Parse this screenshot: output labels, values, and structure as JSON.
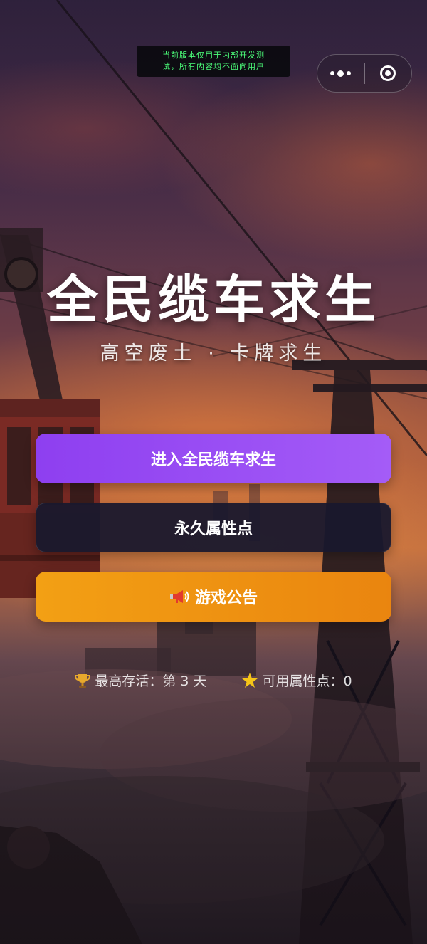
{
  "debug_banner": {
    "line1": "当前版本仅用于内部开发测",
    "line2": "试，所有内容均不面向用户"
  },
  "capsule": {
    "more_icon": "more-dots-icon",
    "close_icon": "close-target-icon"
  },
  "hero": {
    "title": "全民缆车求生",
    "subtitle": "高空废土 · 卡牌求生"
  },
  "buttons": {
    "enter": "进入全民缆车求生",
    "attributes": "永久属性点",
    "notice": "游戏公告",
    "notice_icon": "megaphone-icon"
  },
  "stats": {
    "best_survival": "最高存活：第 3 天",
    "best_survival_icon": "trophy-icon",
    "points": "可用属性点：0",
    "points_icon": "star-icon"
  },
  "colors": {
    "enter_button": "#9a4ff5",
    "attributes_button": "#191a2e",
    "notice_button": "#f0951a",
    "debug_text": "#4cff7a"
  }
}
